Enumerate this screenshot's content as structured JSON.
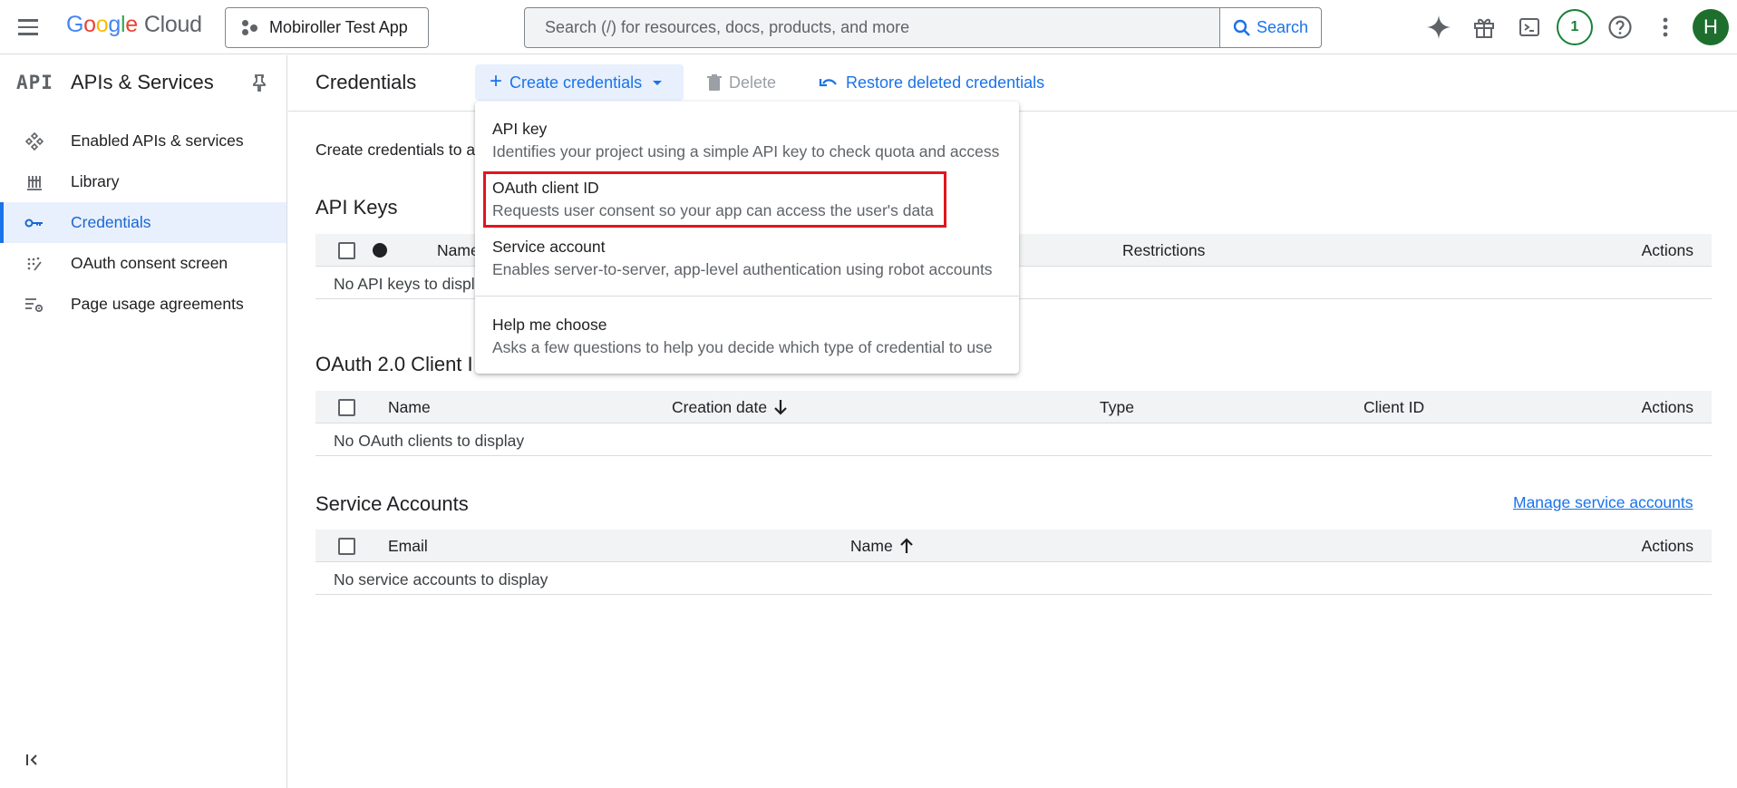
{
  "topbar": {
    "logo_google": "Google",
    "logo_cloud": "Cloud",
    "project_name": "Mobiroller Test App",
    "search_placeholder": "Search (/) for resources, docs, products, and more",
    "search_button": "Search",
    "notification_count": "1",
    "avatar_initial": "H",
    "brand_colors": {
      "blue": "#4285f4",
      "red": "#ea4335",
      "yellow": "#fbbc04",
      "green": "#34a853"
    }
  },
  "sidebar": {
    "title": "APIs & Services",
    "api_logo": "API",
    "items": [
      {
        "label": "Enabled APIs & services",
        "icon": "enabled-apis-icon"
      },
      {
        "label": "Library",
        "icon": "library-icon"
      },
      {
        "label": "Credentials",
        "icon": "key-icon",
        "active": true
      },
      {
        "label": "OAuth consent screen",
        "icon": "oauth-icon"
      },
      {
        "label": "Page usage agreements",
        "icon": "settings-list-icon"
      }
    ]
  },
  "header": {
    "title": "Credentials",
    "create_label": "Create credentials",
    "delete_label": "Delete",
    "restore_label": "Restore deleted credentials"
  },
  "main": {
    "intro": "Create credentials to a",
    "api_keys": {
      "title": "API Keys",
      "columns": [
        "Name",
        "Restrictions",
        "Actions"
      ],
      "empty": "No API keys to displ"
    },
    "oauth": {
      "title": "OAuth 2.0 Client I",
      "columns": [
        "Name",
        "Creation date",
        "Type",
        "Client ID",
        "Actions"
      ],
      "empty": "No OAuth clients to display"
    },
    "service_accounts": {
      "title": "Service Accounts",
      "manage_link": "Manage service accounts",
      "columns": [
        "Email",
        "Name",
        "Actions"
      ],
      "empty": "No service accounts to display"
    }
  },
  "menu": {
    "items": [
      {
        "title": "API key",
        "desc": "Identifies your project using a simple API key to check quota and access"
      },
      {
        "title": "OAuth client ID",
        "desc": "Requests user consent so your app can access the user's data",
        "highlighted": true
      },
      {
        "title": "Service account",
        "desc": "Enables server-to-server, app-level authentication using robot accounts"
      },
      {
        "title": "Help me choose",
        "desc": "Asks a few questions to help you decide which type of credential to use"
      }
    ],
    "highlight_color": "#e0161e"
  }
}
